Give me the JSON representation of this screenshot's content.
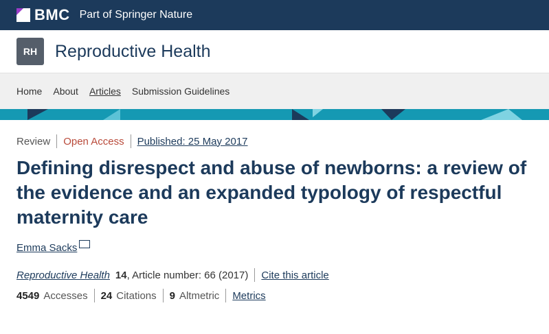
{
  "topbar": {
    "brand": "BMC",
    "tagline": "Part of Springer Nature"
  },
  "journal": {
    "logo_text": "RH",
    "title": "Reproductive Health"
  },
  "nav": {
    "items": [
      "Home",
      "About",
      "Articles",
      "Submission Guidelines"
    ],
    "active": "Articles"
  },
  "article": {
    "type": "Review",
    "access": "Open Access",
    "published": "Published: 25 May 2017",
    "title": "Defining disrespect and abuse of newborns: a review of the evidence and an expanded typology of respectful maternity care",
    "author": "Emma Sacks",
    "journal_name": "Reproductive Health",
    "volume": "14",
    "article_number": ", Article number: 66 (2017)",
    "cite_label": "Cite this article"
  },
  "metrics": {
    "accesses_value": "4549",
    "accesses_label": "Accesses",
    "citations_value": "24",
    "citations_label": "Citations",
    "altmetric_value": "9",
    "altmetric_label": "Altmetric",
    "metrics_link": "Metrics"
  },
  "colors": {
    "topbar": "#1c3a5b",
    "stripe": "#1599b3",
    "title": "#1c3a5b",
    "open_access": "#b94a3a"
  }
}
